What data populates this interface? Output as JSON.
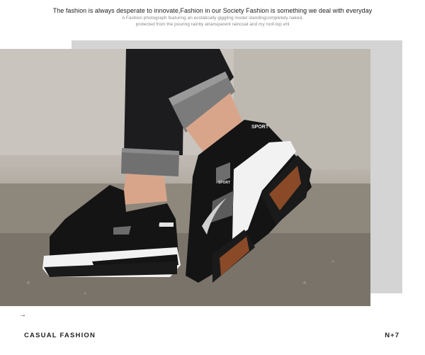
{
  "header": {
    "tagline": "The fashion is always desperate to innovate,Fashion in our Society Fashion is something we deal with everyday",
    "subline_1": "A Fashion photograph featuring an ecstatically giggling model standingcompletely naked,",
    "subline_2": "protected from the pouring rainby atransparent raincoat and my roof-top ehl"
  },
  "photo": {
    "description_icon": "sneaker-photo",
    "shoe_brand_text": "SPORT"
  },
  "footer": {
    "arrow_icon": "arrow-right-icon",
    "arrow_glyph": "→",
    "left_label": "CASUAL FASHION",
    "right_label": "N+7"
  },
  "colors": {
    "shoe": "#141414",
    "sole_white": "#f2f2f2",
    "outsole": "#8a4a28",
    "jeans": "#1c1c1e",
    "skin": "#d9a58a",
    "panel": "#d4d4d4"
  }
}
